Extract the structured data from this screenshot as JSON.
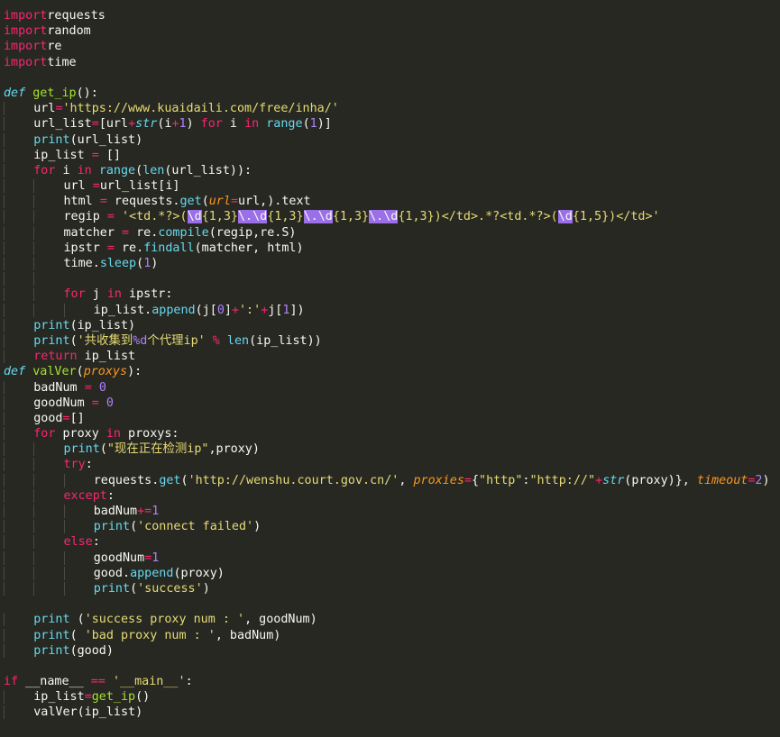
{
  "editor": {
    "theme_colors": {
      "background": "#272822",
      "text": "#F8F8F2",
      "keyword": "#F92672",
      "builtin": "#66D9EF",
      "function": "#A6E22E",
      "string": "#E6DB74",
      "number": "#AE81FF",
      "parameter": "#FD971F",
      "regex_highlight": "#9a6fe8"
    },
    "lines": [
      [
        [
          "kw",
          "import"
        ],
        [
          "",
          "requests"
        ]
      ],
      [
        [
          "kw",
          "import"
        ],
        [
          "",
          "random"
        ]
      ],
      [
        [
          "kw",
          "import"
        ],
        [
          "",
          "re"
        ]
      ],
      [
        [
          "kw",
          "import"
        ],
        [
          "",
          "time"
        ]
      ],
      [],
      [
        [
          "decl",
          "def"
        ],
        [
          "",
          " "
        ],
        [
          "fn",
          "get_ip"
        ],
        [
          "",
          "():"
        ]
      ],
      [
        [
          "ind",
          "    "
        ],
        [
          "",
          "url"
        ],
        [
          "op",
          "="
        ],
        [
          "str",
          "'https://www.kuaidaili.com/free/inha/'"
        ]
      ],
      [
        [
          "ind",
          "    "
        ],
        [
          "",
          "url_list"
        ],
        [
          "op",
          "="
        ],
        [
          "",
          "[url"
        ],
        [
          "op",
          "+"
        ],
        [
          "decl",
          "str"
        ],
        [
          "",
          "(i"
        ],
        [
          "op",
          "+"
        ],
        [
          "num",
          "1"
        ],
        [
          "",
          ")"
        ],
        [
          "kw",
          " for"
        ],
        [
          "",
          " i "
        ],
        [
          "kw",
          "in"
        ],
        [
          "",
          " "
        ],
        [
          "bi",
          "range"
        ],
        [
          "",
          "("
        ],
        [
          "num",
          "1"
        ],
        [
          "",
          ")]"
        ]
      ],
      [
        [
          "ind",
          "    "
        ],
        [
          "bi",
          "print"
        ],
        [
          "",
          "(url_list)"
        ]
      ],
      [
        [
          "ind",
          "    "
        ],
        [
          "",
          "ip_list "
        ],
        [
          "op",
          "="
        ],
        [
          "",
          " []"
        ]
      ],
      [
        [
          "ind",
          "    "
        ],
        [
          "kw",
          "for"
        ],
        [
          "",
          " i "
        ],
        [
          "kw",
          "in"
        ],
        [
          "",
          " "
        ],
        [
          "bi",
          "range"
        ],
        [
          "",
          "("
        ],
        [
          "bi",
          "len"
        ],
        [
          "",
          "(url_list)):"
        ]
      ],
      [
        [
          "ind",
          "    "
        ],
        [
          "ind",
          "    "
        ],
        [
          "",
          "url "
        ],
        [
          "op",
          "="
        ],
        [
          "",
          "url_list[i]"
        ]
      ],
      [
        [
          "ind",
          "    "
        ],
        [
          "ind",
          "    "
        ],
        [
          "",
          "html "
        ],
        [
          "op",
          "="
        ],
        [
          "",
          " requests."
        ],
        [
          "bi",
          "get"
        ],
        [
          "",
          "("
        ],
        [
          "prm",
          "url"
        ],
        [
          "op",
          "="
        ],
        [
          "",
          "url,).text"
        ]
      ],
      [
        [
          "ind",
          "    "
        ],
        [
          "ind",
          "    "
        ],
        [
          "",
          "regip "
        ],
        [
          "op",
          "="
        ],
        [
          "",
          " "
        ],
        [
          "str",
          "'<td.*?>("
        ],
        [
          "hl",
          "\\d"
        ],
        [
          "str",
          "{1,3}"
        ],
        [
          "hl",
          "\\."
        ],
        [
          "hl",
          "\\d"
        ],
        [
          "str",
          "{1,3}"
        ],
        [
          "hl",
          "\\."
        ],
        [
          "hl",
          "\\d"
        ],
        [
          "str",
          "{1,3}"
        ],
        [
          "hl",
          "\\."
        ],
        [
          "hl",
          "\\d"
        ],
        [
          "str",
          "{1,3})</td>.*?<td.*?>("
        ],
        [
          "hl",
          "\\d"
        ],
        [
          "str",
          "{1,5})</td>'"
        ]
      ],
      [
        [
          "ind",
          "    "
        ],
        [
          "ind",
          "    "
        ],
        [
          "",
          "matcher "
        ],
        [
          "op",
          "="
        ],
        [
          "",
          " re."
        ],
        [
          "bi",
          "compile"
        ],
        [
          "",
          "(regip,re.S)"
        ]
      ],
      [
        [
          "ind",
          "    "
        ],
        [
          "ind",
          "    "
        ],
        [
          "",
          "ipstr "
        ],
        [
          "op",
          "="
        ],
        [
          "",
          " re."
        ],
        [
          "bi",
          "findall"
        ],
        [
          "",
          "(matcher, html)"
        ]
      ],
      [
        [
          "ind",
          "    "
        ],
        [
          "ind",
          "    "
        ],
        [
          "",
          "time."
        ],
        [
          "bi",
          "sleep"
        ],
        [
          "",
          "("
        ],
        [
          "num",
          "1"
        ],
        [
          "",
          ")"
        ]
      ],
      [
        [
          "ind",
          "    "
        ],
        [
          "ind",
          "    "
        ]
      ],
      [
        [
          "ind",
          "    "
        ],
        [
          "ind",
          "    "
        ],
        [
          "kw",
          "for"
        ],
        [
          "",
          " j "
        ],
        [
          "kw",
          "in"
        ],
        [
          "",
          " ipstr:"
        ]
      ],
      [
        [
          "ind",
          "    "
        ],
        [
          "ind",
          "    "
        ],
        [
          "ind",
          "    "
        ],
        [
          "",
          "ip_list."
        ],
        [
          "bi",
          "append"
        ],
        [
          "",
          "(j["
        ],
        [
          "num",
          "0"
        ],
        [
          "",
          "]"
        ],
        [
          "op",
          "+"
        ],
        [
          "str",
          "':'"
        ],
        [
          "op",
          "+"
        ],
        [
          "",
          "j["
        ],
        [
          "num",
          "1"
        ],
        [
          "",
          "])"
        ]
      ],
      [
        [
          "ind",
          "    "
        ],
        [
          "bi",
          "print"
        ],
        [
          "",
          "(ip_list)"
        ]
      ],
      [
        [
          "ind",
          "    "
        ],
        [
          "bi",
          "print"
        ],
        [
          "",
          "("
        ],
        [
          "str",
          "'共收集到"
        ],
        [
          "num",
          "%d"
        ],
        [
          "str",
          "个代理ip'"
        ],
        [
          "",
          " "
        ],
        [
          "op",
          "%"
        ],
        [
          "",
          " "
        ],
        [
          "bi",
          "len"
        ],
        [
          "",
          "(ip_list))"
        ]
      ],
      [
        [
          "ind",
          "    "
        ],
        [
          "kw",
          "return"
        ],
        [
          "",
          " ip_list"
        ]
      ],
      [
        [
          "decl",
          "def"
        ],
        [
          "",
          " "
        ],
        [
          "fn",
          "valVer"
        ],
        [
          "",
          "("
        ],
        [
          "prm",
          "proxys"
        ],
        [
          "",
          "):"
        ]
      ],
      [
        [
          "ind",
          "    "
        ],
        [
          "",
          "badNum "
        ],
        [
          "op",
          "="
        ],
        [
          "",
          " "
        ],
        [
          "num",
          "0"
        ]
      ],
      [
        [
          "ind",
          "    "
        ],
        [
          "",
          "goodNum "
        ],
        [
          "op",
          "="
        ],
        [
          "",
          " "
        ],
        [
          "num",
          "0"
        ]
      ],
      [
        [
          "ind",
          "    "
        ],
        [
          "",
          "good"
        ],
        [
          "op",
          "="
        ],
        [
          "",
          "[]"
        ]
      ],
      [
        [
          "ind",
          "    "
        ],
        [
          "kw",
          "for"
        ],
        [
          "",
          " proxy "
        ],
        [
          "kw",
          "in"
        ],
        [
          "",
          " proxys:"
        ]
      ],
      [
        [
          "ind",
          "    "
        ],
        [
          "ind",
          "    "
        ],
        [
          "bi",
          "print"
        ],
        [
          "",
          "("
        ],
        [
          "str",
          "\"现在正在检测ip\""
        ],
        [
          "",
          ",proxy)"
        ]
      ],
      [
        [
          "ind",
          "    "
        ],
        [
          "ind",
          "    "
        ],
        [
          "kw",
          "try"
        ],
        [
          "",
          ":"
        ]
      ],
      [
        [
          "ind",
          "    "
        ],
        [
          "ind",
          "    "
        ],
        [
          "ind",
          "    "
        ],
        [
          "",
          "requests."
        ],
        [
          "bi",
          "get"
        ],
        [
          "",
          "("
        ],
        [
          "str",
          "'http://wenshu.court.gov.cn/'"
        ],
        [
          "",
          ", "
        ],
        [
          "prm",
          "proxies"
        ],
        [
          "op",
          "="
        ],
        [
          "",
          "{"
        ],
        [
          "str",
          "\"http\""
        ],
        [
          "",
          ":"
        ],
        [
          "str",
          "\"http://\""
        ],
        [
          "op",
          "+"
        ],
        [
          "decl",
          "str"
        ],
        [
          "",
          "(proxy)}, "
        ],
        [
          "prm",
          "timeout"
        ],
        [
          "op",
          "="
        ],
        [
          "num",
          "2"
        ],
        [
          "",
          ")"
        ]
      ],
      [
        [
          "ind",
          "    "
        ],
        [
          "ind",
          "    "
        ],
        [
          "kw",
          "except"
        ],
        [
          "",
          ":"
        ]
      ],
      [
        [
          "ind",
          "    "
        ],
        [
          "ind",
          "    "
        ],
        [
          "ind",
          "    "
        ],
        [
          "",
          "badNum"
        ],
        [
          "op",
          "+="
        ],
        [
          "num",
          "1"
        ]
      ],
      [
        [
          "ind",
          "    "
        ],
        [
          "ind",
          "    "
        ],
        [
          "ind",
          "    "
        ],
        [
          "bi",
          "print"
        ],
        [
          "",
          "("
        ],
        [
          "str",
          "'connect failed'"
        ],
        [
          "",
          ")"
        ]
      ],
      [
        [
          "ind",
          "    "
        ],
        [
          "ind",
          "    "
        ],
        [
          "kw",
          "else"
        ],
        [
          "",
          ":"
        ]
      ],
      [
        [
          "ind",
          "    "
        ],
        [
          "ind",
          "    "
        ],
        [
          "ind",
          "    "
        ],
        [
          "",
          "goodNum"
        ],
        [
          "op",
          "="
        ],
        [
          "num",
          "1"
        ]
      ],
      [
        [
          "ind",
          "    "
        ],
        [
          "ind",
          "    "
        ],
        [
          "ind",
          "    "
        ],
        [
          "",
          "good."
        ],
        [
          "bi",
          "append"
        ],
        [
          "",
          "(proxy)"
        ]
      ],
      [
        [
          "ind",
          "    "
        ],
        [
          "ind",
          "    "
        ],
        [
          "ind",
          "    "
        ],
        [
          "bi",
          "print"
        ],
        [
          "",
          "("
        ],
        [
          "str",
          "'success'"
        ],
        [
          "",
          ")"
        ]
      ],
      [],
      [
        [
          "ind",
          "    "
        ],
        [
          "bi",
          "print"
        ],
        [
          "",
          " ("
        ],
        [
          "str",
          "'success proxy num : '"
        ],
        [
          "",
          ", goodNum)"
        ]
      ],
      [
        [
          "ind",
          "    "
        ],
        [
          "bi",
          "print"
        ],
        [
          "",
          "( "
        ],
        [
          "str",
          "'bad proxy num : '"
        ],
        [
          "",
          ", badNum)"
        ]
      ],
      [
        [
          "ind",
          "    "
        ],
        [
          "bi",
          "print"
        ],
        [
          "",
          "(good)"
        ]
      ],
      [],
      [
        [
          "kw",
          "if"
        ],
        [
          "",
          " __name__ "
        ],
        [
          "op",
          "=="
        ],
        [
          "",
          " "
        ],
        [
          "str",
          "'__main__'"
        ],
        [
          "",
          ":"
        ]
      ],
      [
        [
          "ind",
          "    "
        ],
        [
          "",
          "ip_list"
        ],
        [
          "op",
          "="
        ],
        [
          "fn",
          "get_ip"
        ],
        [
          "",
          "()"
        ]
      ],
      [
        [
          "ind",
          "    "
        ],
        [
          "",
          "valVer(ip_list)"
        ]
      ]
    ]
  }
}
